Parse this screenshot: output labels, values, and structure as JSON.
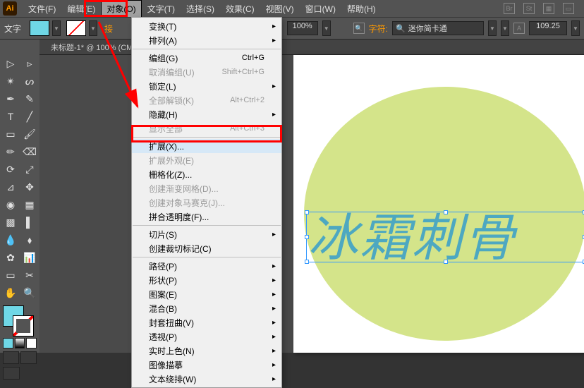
{
  "menubar": {
    "items": [
      "文件(F)",
      "编辑(E)",
      "对象(O)",
      "文字(T)",
      "选择(S)",
      "效果(C)",
      "视图(V)",
      "窗口(W)",
      "帮助(H)"
    ],
    "active_index": 2
  },
  "optionbar": {
    "label": "文字",
    "hint": "接",
    "zoom": "100%",
    "font_label": "字符:",
    "font_name": "迷你简卡通",
    "size": "109.25"
  },
  "tab": {
    "title": "未标题-1* @ 100% (CM"
  },
  "dropdown": [
    {
      "type": "item",
      "label": "变换(T)",
      "submenu": true
    },
    {
      "type": "item",
      "label": "排列(A)",
      "submenu": true
    },
    {
      "type": "sep"
    },
    {
      "type": "item",
      "label": "编组(G)",
      "shortcut": "Ctrl+G"
    },
    {
      "type": "item",
      "label": "取消编组(U)",
      "shortcut": "Shift+Ctrl+G",
      "disabled": true
    },
    {
      "type": "item",
      "label": "锁定(L)",
      "submenu": true
    },
    {
      "type": "item",
      "label": "全部解锁(K)",
      "shortcut": "Alt+Ctrl+2",
      "disabled": true
    },
    {
      "type": "item",
      "label": "隐藏(H)",
      "submenu": true
    },
    {
      "type": "item",
      "label": "显示全部",
      "shortcut": "Alt+Ctrl+3",
      "disabled": true
    },
    {
      "type": "sep"
    },
    {
      "type": "item",
      "label": "扩展(X)...",
      "highlighted": true
    },
    {
      "type": "item",
      "label": "扩展外观(E)",
      "disabled": true
    },
    {
      "type": "item",
      "label": "栅格化(Z)..."
    },
    {
      "type": "item",
      "label": "创建渐变网格(D)...",
      "disabled": true
    },
    {
      "type": "item",
      "label": "创建对象马赛克(J)...",
      "disabled": true
    },
    {
      "type": "item",
      "label": "拼合透明度(F)..."
    },
    {
      "type": "sep"
    },
    {
      "type": "item",
      "label": "切片(S)",
      "submenu": true
    },
    {
      "type": "item",
      "label": "创建裁切标记(C)"
    },
    {
      "type": "sep"
    },
    {
      "type": "item",
      "label": "路径(P)",
      "submenu": true
    },
    {
      "type": "item",
      "label": "形状(P)",
      "submenu": true
    },
    {
      "type": "item",
      "label": "图案(E)",
      "submenu": true
    },
    {
      "type": "item",
      "label": "混合(B)",
      "submenu": true
    },
    {
      "type": "item",
      "label": "封套扭曲(V)",
      "submenu": true
    },
    {
      "type": "item",
      "label": "透视(P)",
      "submenu": true
    },
    {
      "type": "item",
      "label": "实时上色(N)",
      "submenu": true
    },
    {
      "type": "item",
      "label": "图像描摹",
      "submenu": true
    },
    {
      "type": "item",
      "label": "文本绕排(W)",
      "submenu": true
    }
  ],
  "canvas": {
    "text": "冰霜刺骨"
  },
  "colors": {
    "accent": "#6fd7e6",
    "ellipse": "#d4e48a",
    "text": "#4da8c1",
    "annotation": "#ff0000"
  }
}
